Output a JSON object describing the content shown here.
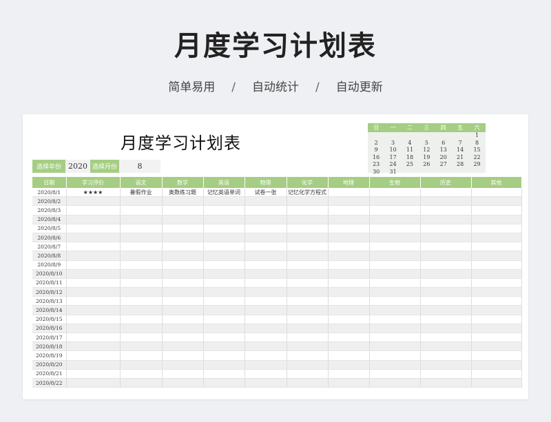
{
  "header": {
    "title": "月度学习计划表",
    "features": [
      "简单易用",
      "自动统计",
      "自动更新"
    ],
    "separator": "/"
  },
  "sheet": {
    "title": "月度学习计划表",
    "year_label": "选择年份",
    "year_value": "2020",
    "month_label": "选择月份",
    "month_value": "8"
  },
  "calendar": {
    "weekdays": [
      "日",
      "一",
      "二",
      "三",
      "四",
      "五",
      "六"
    ],
    "weeks": [
      [
        "",
        "",
        "",
        "",
        "",
        "",
        "1"
      ],
      [
        "2",
        "3",
        "4",
        "5",
        "6",
        "7",
        "8"
      ],
      [
        "9",
        "10",
        "11",
        "12",
        "13",
        "14",
        "15"
      ],
      [
        "16",
        "17",
        "18",
        "19",
        "20",
        "21",
        "22"
      ],
      [
        "23",
        "24",
        "25",
        "26",
        "27",
        "28",
        "29"
      ],
      [
        "30",
        "31",
        "",
        "",
        "",
        "",
        ""
      ]
    ]
  },
  "table": {
    "columns": [
      "日期",
      "学习评价",
      "语文",
      "数学",
      "英语",
      "物理",
      "化学",
      "地理",
      "生物",
      "历史",
      "其他"
    ],
    "rows": [
      [
        "2020/8/1",
        "★★★★",
        "暑假作业",
        "奥数练习题",
        "记忆英语单词",
        "试卷一张",
        "记忆化学方程式",
        "",
        "",
        "",
        ""
      ],
      [
        "2020/8/2",
        "",
        "",
        "",
        "",
        "",
        "",
        "",
        "",
        "",
        ""
      ],
      [
        "2020/8/3",
        "",
        "",
        "",
        "",
        "",
        "",
        "",
        "",
        "",
        ""
      ],
      [
        "2020/8/4",
        "",
        "",
        "",
        "",
        "",
        "",
        "",
        "",
        "",
        ""
      ],
      [
        "2020/8/5",
        "",
        "",
        "",
        "",
        "",
        "",
        "",
        "",
        "",
        ""
      ],
      [
        "2020/8/6",
        "",
        "",
        "",
        "",
        "",
        "",
        "",
        "",
        "",
        ""
      ],
      [
        "2020/8/7",
        "",
        "",
        "",
        "",
        "",
        "",
        "",
        "",
        "",
        ""
      ],
      [
        "2020/8/8",
        "",
        "",
        "",
        "",
        "",
        "",
        "",
        "",
        "",
        ""
      ],
      [
        "2020/8/9",
        "",
        "",
        "",
        "",
        "",
        "",
        "",
        "",
        "",
        ""
      ],
      [
        "2020/8/10",
        "",
        "",
        "",
        "",
        "",
        "",
        "",
        "",
        "",
        ""
      ],
      [
        "2020/8/11",
        "",
        "",
        "",
        "",
        "",
        "",
        "",
        "",
        "",
        ""
      ],
      [
        "2020/8/12",
        "",
        "",
        "",
        "",
        "",
        "",
        "",
        "",
        "",
        ""
      ],
      [
        "2020/8/13",
        "",
        "",
        "",
        "",
        "",
        "",
        "",
        "",
        "",
        ""
      ],
      [
        "2020/8/14",
        "",
        "",
        "",
        "",
        "",
        "",
        "",
        "",
        "",
        ""
      ],
      [
        "2020/8/15",
        "",
        "",
        "",
        "",
        "",
        "",
        "",
        "",
        "",
        ""
      ],
      [
        "2020/8/16",
        "",
        "",
        "",
        "",
        "",
        "",
        "",
        "",
        "",
        ""
      ],
      [
        "2020/8/17",
        "",
        "",
        "",
        "",
        "",
        "",
        "",
        "",
        "",
        ""
      ],
      [
        "2020/8/18",
        "",
        "",
        "",
        "",
        "",
        "",
        "",
        "",
        "",
        ""
      ],
      [
        "2020/8/19",
        "",
        "",
        "",
        "",
        "",
        "",
        "",
        "",
        "",
        ""
      ],
      [
        "2020/8/20",
        "",
        "",
        "",
        "",
        "",
        "",
        "",
        "",
        "",
        ""
      ],
      [
        "2020/8/21",
        "",
        "",
        "",
        "",
        "",
        "",
        "",
        "",
        "",
        ""
      ],
      [
        "2020/8/22",
        "",
        "",
        "",
        "",
        "",
        "",
        "",
        "",
        "",
        ""
      ]
    ]
  }
}
